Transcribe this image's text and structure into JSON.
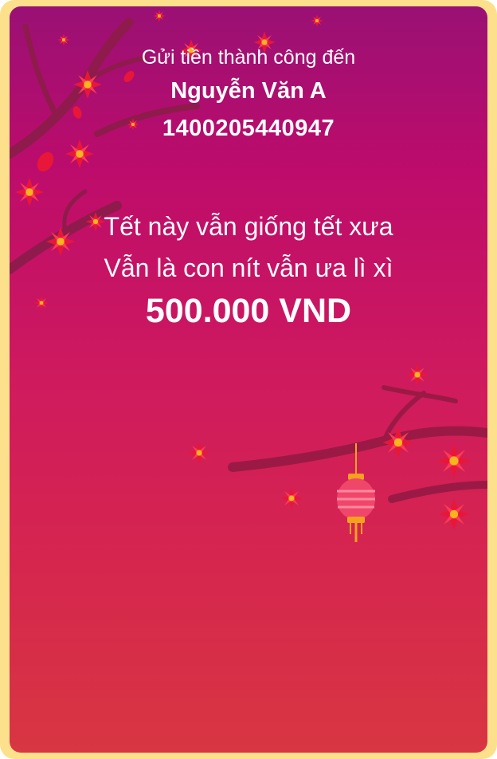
{
  "transfer": {
    "sent_label": "Gửi tiền thành công đến",
    "recipient_name": "Nguyễn Văn A",
    "account_number": "1400205440947"
  },
  "greeting": {
    "line1": "Tết này vẫn giống tết xưa",
    "line2": "Vẫn là con nít vẫn ưa lì xì"
  },
  "amount": "500.000 VND",
  "colors": {
    "frame": "#fde08c",
    "top": "#9a1074",
    "bottom": "#d83642",
    "blossom": "#e8173a",
    "branch": "#8e1b4c"
  }
}
